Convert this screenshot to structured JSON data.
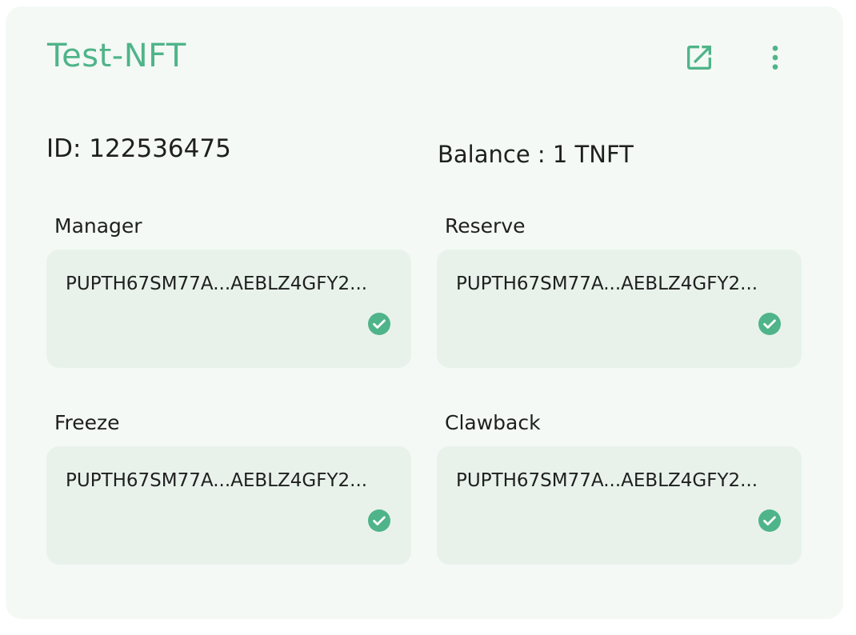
{
  "asset": {
    "name": "Test-NFT",
    "id_text": "ID: 122536475",
    "balance_text": "Balance : 1 TNFT"
  },
  "header_actions": {
    "open_icon": "open-in-new-icon",
    "menu_icon": "more-vertical-icon"
  },
  "roles": [
    {
      "label": "Manager",
      "address": "PUPTH67SM77A...AEBLZ4GFY2...",
      "verified_icon": "check-circle-icon"
    },
    {
      "label": "Reserve",
      "address": "PUPTH67SM77A...AEBLZ4GFY2...",
      "verified_icon": "check-circle-icon"
    },
    {
      "label": "Freeze",
      "address": "PUPTH67SM77A...AEBLZ4GFY2...",
      "verified_icon": "check-circle-icon"
    },
    {
      "label": "Clawback",
      "address": "PUPTH67SM77A...AEBLZ4GFY2...",
      "verified_icon": "check-circle-icon"
    }
  ],
  "colors": {
    "accent": "#4fb489",
    "card_bg": "#f4f9f5",
    "box_bg": "#e8f2eb",
    "text": "#1f1f1f"
  }
}
